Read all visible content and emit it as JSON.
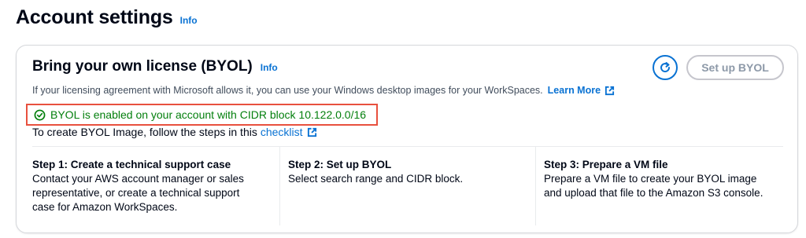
{
  "header": {
    "title": "Account settings",
    "info_label": "Info"
  },
  "card": {
    "title": "Bring your own license (BYOL)",
    "info_label": "Info",
    "setup_button_label": "Set up BYOL",
    "description": "If your licensing agreement with Microsoft allows it, you can use your Windows desktop images for your WorkSpaces.",
    "learn_more_label": "Learn More",
    "status_text": "BYOL is enabled on your account with CIDR block 10.122.0.0/16",
    "checklist_prefix": "To create BYOL Image, follow the steps in this",
    "checklist_link": "checklist",
    "steps": [
      {
        "title": "Step 1: Create a technical support case",
        "lines": [
          "Contact your AWS account manager or sales",
          "representative, or create a technical support",
          "case for Amazon WorkSpaces."
        ]
      },
      {
        "title": "Step 2: Set up BYOL",
        "lines": [
          "Select search range and CIDR block."
        ]
      },
      {
        "title": "Step 3: Prepare a VM file",
        "lines": [
          "Prepare a VM file to create your BYOL image",
          "and upload that file to the Amazon S3 console."
        ]
      }
    ]
  },
  "colors": {
    "link": "#0972d3",
    "success": "#037f0c",
    "highlight_border": "#e8503e",
    "disabled": "#8d99a8"
  },
  "icons": {
    "refresh": "refresh-icon",
    "external": "external-link-icon",
    "status": "check-circle-icon"
  }
}
